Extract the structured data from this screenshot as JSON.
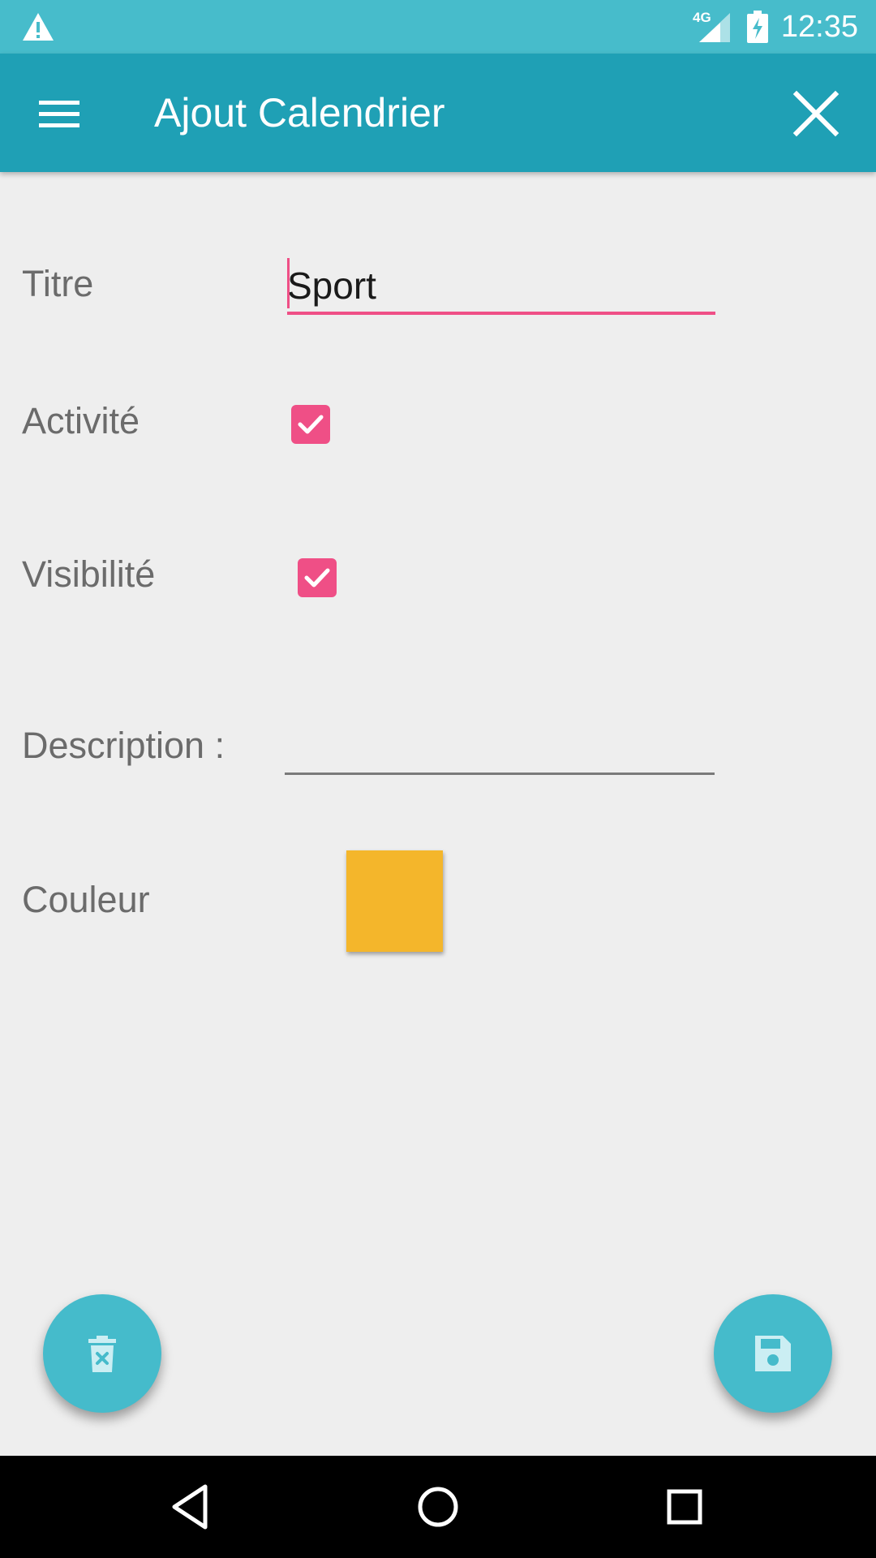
{
  "status_bar": {
    "time": "12:35",
    "network": "4G",
    "icons": [
      "warning-icon",
      "signal-icon",
      "battery-charging-icon"
    ]
  },
  "app_bar": {
    "title": "Ajout Calendrier",
    "icons": [
      "menu-icon",
      "close-icon"
    ]
  },
  "form": {
    "titre": {
      "label": "Titre",
      "value": "Sport",
      "placeholder": ""
    },
    "activite": {
      "label": "Activité",
      "checked": true
    },
    "visibilite": {
      "label": "Visibilité",
      "checked": true
    },
    "description": {
      "label": "Description :",
      "value": "",
      "placeholder": ""
    },
    "couleur": {
      "label": "Couleur",
      "color": "#f4b62b"
    }
  },
  "fabs": {
    "delete_icon": "delete-icon",
    "save_icon": "save-icon"
  },
  "nav": {
    "icons": [
      "back-icon",
      "home-icon",
      "recents-icon"
    ]
  },
  "colors": {
    "status_bar": "#47bccb",
    "app_bar": "#1fa0b5",
    "accent": "#ef4f86",
    "fab": "#45bbcb",
    "background": "#eeeeee"
  }
}
